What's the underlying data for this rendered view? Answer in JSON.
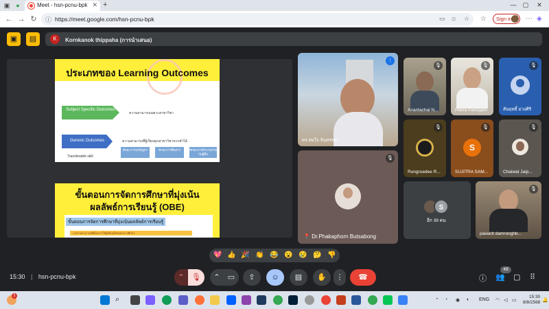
{
  "browser": {
    "tab_title": "Meet - hsn-pcnu-bpk",
    "url": "https://meet.google.com/hsn-pcnu-bpk",
    "sign_in": "Sign in"
  },
  "meet": {
    "presenter_initial": "K",
    "presenter_name": "Kornkanok thippaha (การนำเสนอ)"
  },
  "slide1": {
    "heading": "ประเภทของ Learning Outcomes",
    "subject_specific": "Subject Specific Outcomes",
    "subject_specific_desc": "ความสามารถเฉพาะสาขาวิชา",
    "generic_outcomes": "Generic Outcomes",
    "generic_desc": "ความสามารถที่ผู้เรียนทุกสาขาวิชาควรทำได้",
    "transferable": "Transferable skill",
    "skills": [
      "ทักษะการแก้ปัญหา",
      "ทักษะการสื่อสาร",
      "ทักษะการทำงานร่วมกับผู้อื่น"
    ]
  },
  "slide2": {
    "heading1": "ขั้นตอนการจัดการศึกษาที่มุ่งเน้น",
    "heading2": "ผลลัพธ์การเรียนรู้ (OBE)",
    "sub": "ขั้นตอนการจัดการศึกษาที่มุ่งเน้นผลลัพธ์การเรียนรู้",
    "item": "1.ความสามารถที่ต้องการให้ผู้เรียนมีหลังจบการศึกษา"
  },
  "participants": [
    {
      "name": "ดร.สมใจ จันทรทอง",
      "muted": false
    },
    {
      "name": "Anantachai N...",
      "muted": true
    },
    {
      "name": "Peera Panngam",
      "muted": true
    },
    {
      "name": "สันฤทธิ์ ม่วงศิริ",
      "muted": true
    },
    {
      "name": "Dr.Phakaphorn Butsabong",
      "muted": true
    },
    {
      "name": "Rungruedee R...",
      "muted": true
    },
    {
      "name": "SUJITRA SAM...",
      "muted": true,
      "initial": "S"
    },
    {
      "name": "Chaiwat Jaip...",
      "muted": true
    },
    {
      "name": "pawarit damronghb...",
      "muted": true
    }
  ],
  "others": {
    "initial": "S",
    "label": "อีก 39 คน"
  },
  "reactions": [
    "💖",
    "👍",
    "🎉",
    "👏",
    "😂",
    "😮",
    "😢",
    "🤔",
    "👎"
  ],
  "bottom": {
    "time": "15:30",
    "separator": "|",
    "meeting_code": "hsn-pcnu-bpk",
    "people_count": "49"
  },
  "taskbar": {
    "language": "ENG",
    "time": "15:30",
    "date": "8/8/2568",
    "weather_badge": "5"
  },
  "colors": {
    "accent_yellow": "#fbbc04",
    "end_call_red": "#ea4335",
    "slide_yellow": "#ffef3a",
    "background": "#202124"
  }
}
